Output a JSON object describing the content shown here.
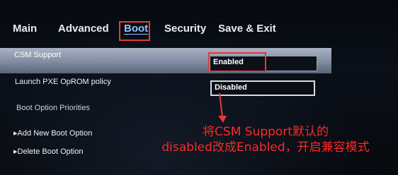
{
  "menu": {
    "tabs": [
      {
        "label": "Main"
      },
      {
        "label": "Advanced"
      },
      {
        "label": "Boot"
      },
      {
        "label": "Security"
      },
      {
        "label": "Save & Exit"
      }
    ],
    "active_tab": "Boot",
    "active_color": "#8fc3ff"
  },
  "settings": {
    "csm_support": {
      "label": "CSM Support",
      "value": "Enabled"
    },
    "pxe_policy": {
      "label": "Launch PXE OpROM policy",
      "value": "Disabled"
    },
    "boot_option_priorities": {
      "label": "Boot Option Priorities"
    },
    "add_boot_option": {
      "label": "Add New Boot Option"
    },
    "delete_boot_option": {
      "label": "Delete Boot Option"
    }
  },
  "annotation": {
    "line1": "将CSM Support默认的",
    "line2": "disabled改成Enabled，开启兼容模式",
    "color": "#ff2b2b"
  },
  "highlight_color": "#e53a3a",
  "icons": {
    "submenu_arrow": "triangle-right-icon",
    "annotation_arrow": "arrow-pointer-icon"
  }
}
